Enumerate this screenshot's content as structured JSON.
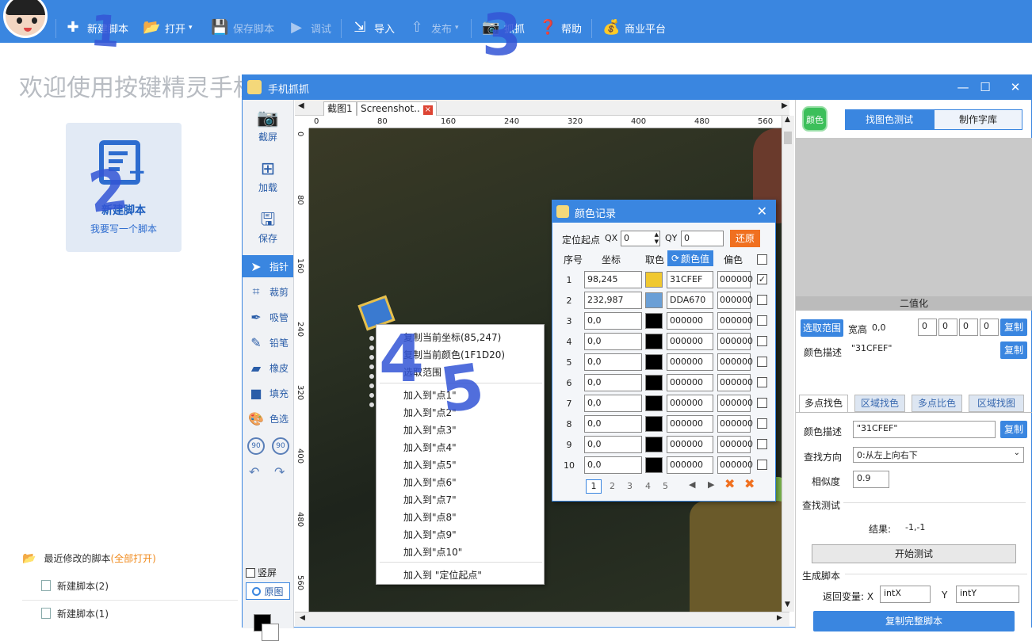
{
  "toolbar": {
    "new_script": "新建脚本",
    "open": "打开",
    "save_script": "保存脚本",
    "debug": "调试",
    "import": "导入",
    "publish": "发布",
    "capture": "抓抓",
    "help": "帮助",
    "business": "商业平台"
  },
  "home": {
    "welcome": "欢迎使用按键精灵手机助手",
    "new_card_title": "新建脚本",
    "new_card_sub": "我要写一个脚本",
    "recent_label": "最近修改的脚本",
    "recent_open_all": "(全部打开)",
    "recent_files": [
      "新建脚本(2)",
      "新建脚本(1)"
    ]
  },
  "capture_window": {
    "title": "手机抓抓",
    "left_tools": {
      "screenshot": "截屏",
      "load": "加载",
      "save": "保存",
      "pointer": "指针",
      "crop": "裁剪",
      "eyedropper": "吸管",
      "pencil": "铅笔",
      "eraser": "橡皮",
      "fill": "填充",
      "pick_color": "色选",
      "rotate_left_label": "90",
      "rotate_right_label": "90",
      "portrait": "竖屏",
      "original": "原图"
    },
    "tabs": [
      "截图1",
      "Screenshot.."
    ],
    "ruler_h": [
      "0",
      "80",
      "160",
      "240",
      "320",
      "400",
      "480",
      "560"
    ],
    "ruler_v": [
      "0",
      "80",
      "160",
      "240",
      "320",
      "400",
      "480",
      "560"
    ]
  },
  "right_panel": {
    "color_btn": "颜色",
    "tab_find_test": "找图色测试",
    "tab_make_lib": "制作字库",
    "binarize": "二值化",
    "select_range": "选取范围",
    "wh_label": "宽高",
    "wh_value": "0,0",
    "range_values": [
      "0",
      "0",
      "0",
      "0"
    ],
    "copy": "复制",
    "color_desc_label": "颜色描述",
    "color_desc_value": "\"31CFEF\"",
    "subtabs": [
      "多点找色",
      "区域找色",
      "多点比色",
      "区域找图"
    ],
    "find_color_desc_label": "颜色描述",
    "find_color_desc_value": "\"31CFEF\"",
    "find_dir_label": "查找方向",
    "find_dir_value": "0:从左上向右下",
    "similarity_label": "相似度",
    "similarity_value": "0.9",
    "find_test_label": "查找测试",
    "result_label": "结果:",
    "result_value": "-1,-1",
    "start_test": "开始测试",
    "gen_script": "生成脚本",
    "return_var": "返回变量: X",
    "var_x": "intX",
    "var_y_label": "Y",
    "var_y": "intY",
    "copy_full": "复制完整脚本"
  },
  "color_dialog": {
    "title": "颜色记录",
    "origin_label": "定位起点",
    "qx_label": "QX",
    "qx_value": "0",
    "qy_label": "QY",
    "qy_value": "0",
    "restore": "还原",
    "col_idx": "序号",
    "col_coord": "坐标",
    "col_pick": "取色",
    "col_value": "颜色值",
    "col_offset": "偏色",
    "rows": [
      {
        "n": "1",
        "xy": "98,245",
        "swatch": "#f0c830",
        "hex": "31CFEF",
        "off": "000000",
        "checked": true
      },
      {
        "n": "2",
        "xy": "232,987",
        "swatch": "#6a9fd6",
        "hex": "DDA670",
        "off": "000000",
        "checked": false
      },
      {
        "n": "3",
        "xy": "0,0",
        "swatch": "#000000",
        "hex": "000000",
        "off": "000000",
        "checked": false
      },
      {
        "n": "4",
        "xy": "0,0",
        "swatch": "#000000",
        "hex": "000000",
        "off": "000000",
        "checked": false
      },
      {
        "n": "5",
        "xy": "0,0",
        "swatch": "#000000",
        "hex": "000000",
        "off": "000000",
        "checked": false
      },
      {
        "n": "6",
        "xy": "0,0",
        "swatch": "#000000",
        "hex": "000000",
        "off": "000000",
        "checked": false
      },
      {
        "n": "7",
        "xy": "0,0",
        "swatch": "#000000",
        "hex": "000000",
        "off": "000000",
        "checked": false
      },
      {
        "n": "8",
        "xy": "0,0",
        "swatch": "#000000",
        "hex": "000000",
        "off": "000000",
        "checked": false
      },
      {
        "n": "9",
        "xy": "0,0",
        "swatch": "#000000",
        "hex": "000000",
        "off": "000000",
        "checked": false
      },
      {
        "n": "10",
        "xy": "0,0",
        "swatch": "#000000",
        "hex": "000000",
        "off": "000000",
        "checked": false
      }
    ],
    "pages": [
      "1",
      "2",
      "3",
      "4",
      "5"
    ]
  },
  "context_menu": {
    "items": [
      "复制当前坐标(85,247)",
      "复制当前颜色(1F1D20)",
      "选取范围",
      "加入到\"点1\"",
      "加入到\"点2\"",
      "加入到\"点3\"",
      "加入到\"点4\"",
      "加入到\"点5\"",
      "加入到\"点6\"",
      "加入到\"点7\"",
      "加入到\"点8\"",
      "加入到\"点9\"",
      "加入到\"点10\"",
      "加入到 \"定位起点\""
    ]
  },
  "annotations": [
    "1",
    "2",
    "3",
    "4",
    "5"
  ],
  "colors": {
    "accent": "#3a86e0",
    "orange": "#f07020"
  }
}
